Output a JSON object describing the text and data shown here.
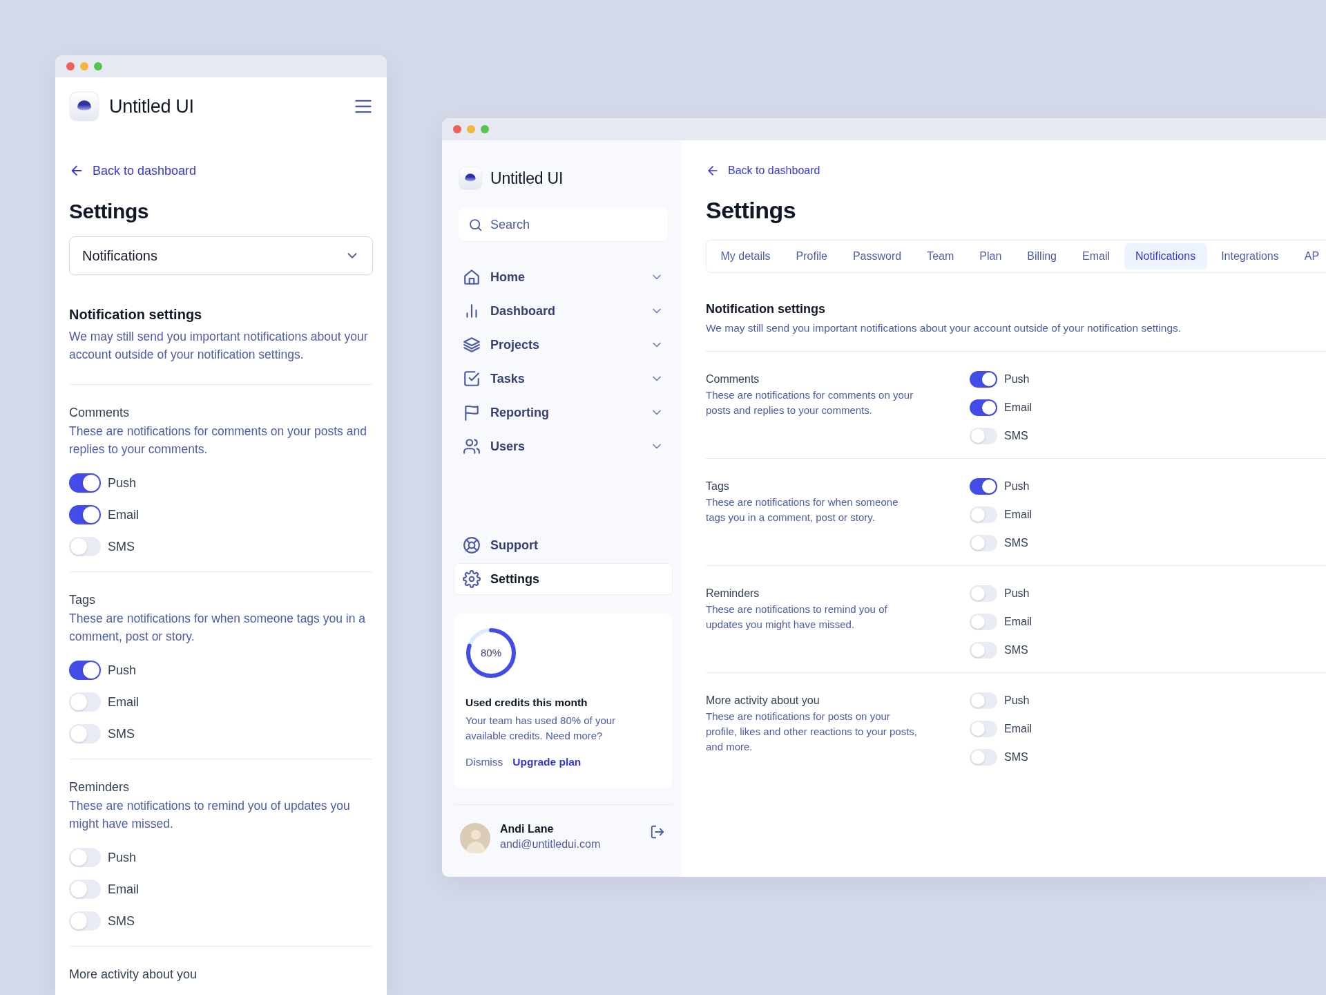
{
  "mobile": {
    "brand": "Untitled UI",
    "back_link": "Back to dashboard",
    "title": "Settings",
    "select": {
      "value": "Notifications"
    },
    "heading": "Notification settings",
    "description": "We may still send you important notifications about your account outside of your notification settings.",
    "sections": [
      {
        "title": "Comments",
        "description": "These are notifications for comments on your posts and replies to your comments.",
        "toggles": [
          {
            "label": "Push",
            "on": true
          },
          {
            "label": "Email",
            "on": true
          },
          {
            "label": "SMS",
            "on": false
          }
        ]
      },
      {
        "title": "Tags",
        "description": "These are notifications for when someone tags you in a comment, post or story.",
        "toggles": [
          {
            "label": "Push",
            "on": true
          },
          {
            "label": "Email",
            "on": false
          },
          {
            "label": "SMS",
            "on": false
          }
        ]
      },
      {
        "title": "Reminders",
        "description": "These are notifications to remind you of updates you might have missed.",
        "toggles": [
          {
            "label": "Push",
            "on": false
          },
          {
            "label": "Email",
            "on": false
          },
          {
            "label": "SMS",
            "on": false
          }
        ]
      },
      {
        "title": "More activity about you"
      }
    ]
  },
  "desktop": {
    "sidebar": {
      "brand": "Untitled UI",
      "search": {
        "placeholder": "Search"
      },
      "nav": [
        {
          "label": "Home"
        },
        {
          "label": "Dashboard"
        },
        {
          "label": "Projects"
        },
        {
          "label": "Tasks"
        },
        {
          "label": "Reporting"
        },
        {
          "label": "Users"
        }
      ],
      "footer_nav": [
        {
          "label": "Support",
          "selected": false
        },
        {
          "label": "Settings",
          "selected": true
        }
      ],
      "credits": {
        "percent": "80%",
        "level": 0.8,
        "title": "Used credits this month",
        "text": "Your team has used 80% of your available credits. Need more?",
        "actions": [
          "Dismiss",
          "Upgrade plan"
        ]
      },
      "user": {
        "name": "Andi Lane",
        "email": "andi@untitledui.com"
      }
    },
    "main": {
      "back_link": "Back to dashboard",
      "title": "Settings",
      "tabs": [
        {
          "label": "My details",
          "selected": false
        },
        {
          "label": "Profile",
          "selected": false
        },
        {
          "label": "Password",
          "selected": false
        },
        {
          "label": "Team",
          "selected": false
        },
        {
          "label": "Plan",
          "selected": false
        },
        {
          "label": "Billing",
          "selected": false
        },
        {
          "label": "Email",
          "selected": false
        },
        {
          "label": "Notifications",
          "selected": true
        },
        {
          "label": "Integrations",
          "selected": false
        },
        {
          "label": "AP",
          "selected": false
        }
      ],
      "heading": "Notification settings",
      "description": "We may still send you important notifications about your account outside of your notification settings.",
      "sections": [
        {
          "title": "Comments",
          "description": "These are notifications for comments on your posts and replies to your comments.",
          "toggles": [
            {
              "label": "Push",
              "on": true
            },
            {
              "label": "Email",
              "on": true
            },
            {
              "label": "SMS",
              "on": false
            }
          ]
        },
        {
          "title": "Tags",
          "description": "These are notifications for when someone tags you in a comment, post or story.",
          "toggles": [
            {
              "label": "Push",
              "on": true
            },
            {
              "label": "Email",
              "on": false
            },
            {
              "label": "SMS",
              "on": false
            }
          ]
        },
        {
          "title": "Reminders",
          "description": "These are notifications to remind you of updates you might have missed.",
          "toggles": [
            {
              "label": "Push",
              "on": false
            },
            {
              "label": "Email",
              "on": false
            },
            {
              "label": "SMS",
              "on": false
            }
          ]
        },
        {
          "title": "More activity about you",
          "description": "These are notifications for posts on your profile, likes and other reactions to your posts, and more.",
          "toggles": [
            {
              "label": "Push",
              "on": false
            },
            {
              "label": "Email",
              "on": false
            },
            {
              "label": "SMS",
              "on": false
            }
          ]
        }
      ]
    }
  }
}
